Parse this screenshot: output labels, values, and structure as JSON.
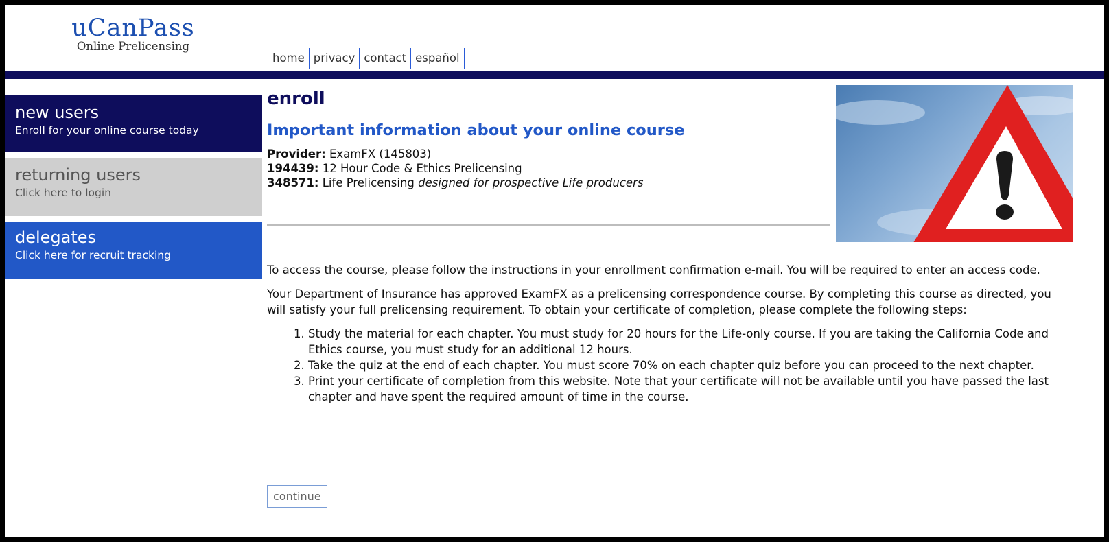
{
  "logo": {
    "main": "uCanPass",
    "sub": "Online Prelicensing"
  },
  "nav": [
    "home",
    "privacy",
    "contact",
    "español"
  ],
  "sidebar": {
    "new": {
      "title": "new users",
      "sub": "Enroll for your online course today"
    },
    "returning": {
      "title": "returning users",
      "sub": "Click here to login"
    },
    "delegates": {
      "title": "delegates",
      "sub": "Click here for recruit tracking"
    }
  },
  "main": {
    "title": "enroll",
    "subtitle": "Important information about your online course",
    "provider_label": "Provider:",
    "provider_value": "ExamFX (145803)",
    "course1_code": "194439:",
    "course1_name": "12 Hour Code & Ethics Prelicensing",
    "course2_code": "348571:",
    "course2_name": "Life Prelicensing",
    "course2_note": "designed for prospective Life producers",
    "para1": "To access the course, please follow the instructions in your enrollment confirmation e-mail. You will be required to enter an access code.",
    "para2": "Your Department of Insurance has approved ExamFX as a prelicensing correspondence course. By completing this course as directed, you will satisfy your full prelicensing requirement. To obtain your certificate of completion, please complete the following steps:",
    "steps": [
      "Study the material for each chapter. You must study for 20 hours for the Life-only course. If you are taking the California Code and Ethics course, you must study for an additional 12 hours.",
      "Take the quiz at the end of each chapter. You must score 70% on each chapter quiz before you can proceed to the next chapter.",
      "Print your certificate of completion from this website. Note that your certificate will not be available until you have passed the last chapter and have spent the required amount of time in the course."
    ],
    "continue_label": "continue"
  },
  "colors": {
    "navy": "#0e0d5c",
    "blue": "#2258c7",
    "gray_box": "#cfcfcf",
    "warning_red": "#e02020"
  }
}
